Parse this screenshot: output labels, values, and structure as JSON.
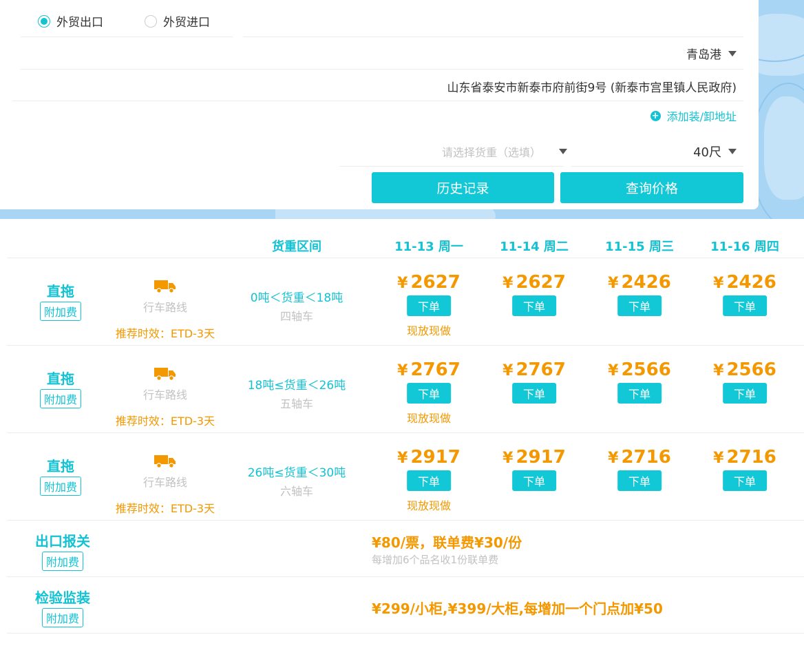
{
  "trade": {
    "options": [
      {
        "label": "外贸出口",
        "checked": true
      },
      {
        "label": "外贸进口",
        "checked": false
      }
    ]
  },
  "form": {
    "port": "青岛港",
    "address": "山东省泰安市新泰市府前街9号 (新泰市宫里镇人民政府)",
    "add_address": "添加装/卸地址",
    "weight_placeholder": "请选择货重（选填）",
    "container_size": "40尺",
    "history_button": "历史记录",
    "query_button": "查询价格"
  },
  "table": {
    "weight_header": "货重区间",
    "dates": [
      "11-13 周一",
      "11-14 周二",
      "11-15 周三",
      "11-16 周四"
    ],
    "rows": [
      {
        "mode": "直拖",
        "surcharge": "附加费",
        "route": "行车路线",
        "eta": "推荐时效：ETD-3天",
        "range": "0吨＜货重＜18吨",
        "axle": "四轴车",
        "prices": [
          "2627",
          "2627",
          "2426",
          "2426"
        ],
        "spot": "现放现做"
      },
      {
        "mode": "直拖",
        "surcharge": "附加费",
        "route": "行车路线",
        "eta": "推荐时效：ETD-3天",
        "range": "18吨≤货重＜26吨",
        "axle": "五轴车",
        "prices": [
          "2767",
          "2767",
          "2566",
          "2566"
        ],
        "spot": "现放现做"
      },
      {
        "mode": "直拖",
        "surcharge": "附加费",
        "route": "行车路线",
        "eta": "推荐时效：ETD-3天",
        "range": "26吨≤货重＜30吨",
        "axle": "六轴车",
        "prices": [
          "2917",
          "2917",
          "2716",
          "2716"
        ],
        "spot": "现放现做"
      }
    ],
    "currency": "¥",
    "order_label": "下单"
  },
  "fees": [
    {
      "title": "出口报关",
      "surcharge": "附加费",
      "text": "¥80/票，联单费¥30/份",
      "note": "每增加6个品名收1份联单费"
    },
    {
      "title": "检验监装",
      "surcharge": "附加费",
      "text": "¥299/小柜,¥399/大柜,每增加一个门点加¥50"
    }
  ],
  "colors": {
    "accent": "#13c2d3",
    "price": "#f39800",
    "muted": "#c2c2c2",
    "map": "#a9d5f4"
  }
}
